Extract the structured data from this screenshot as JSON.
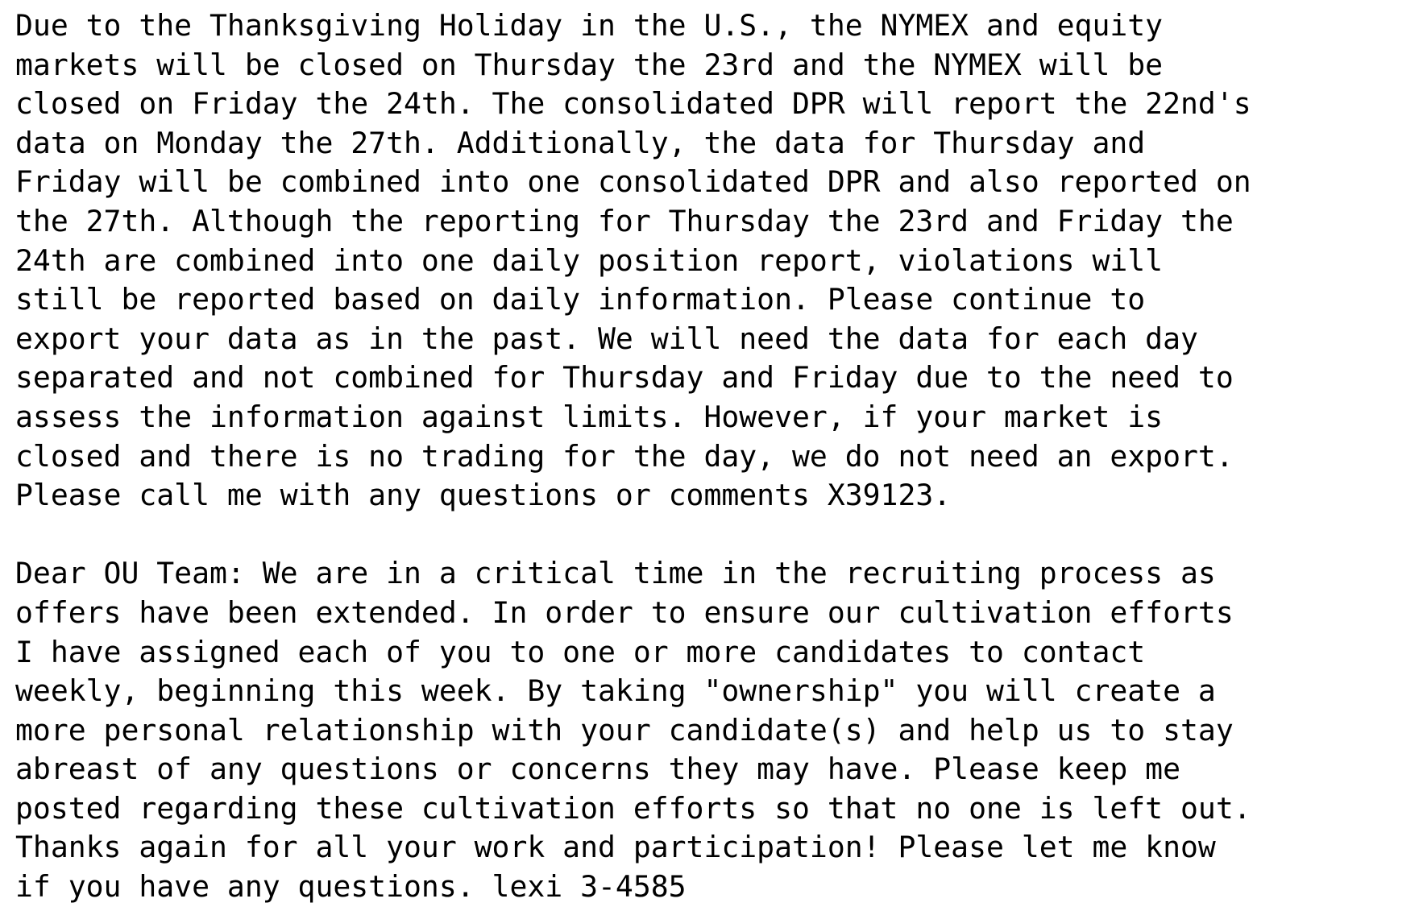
{
  "paragraphs": [
    {
      "lines": [
        "Due to the Thanksgiving Holiday in the U.S., the NYMEX and equity",
        "markets will be closed on Thursday the 23rd and the NYMEX will be",
        "closed on Friday the 24th. The consolidated DPR will report the 22nd's",
        "data on Monday the 27th. Additionally, the data for Thursday and",
        "Friday will be combined into one consolidated DPR and also reported on",
        "the 27th. Although the reporting for Thursday the 23rd and Friday the",
        "24th are combined into one daily position report, violations will",
        "still be reported based on daily information. Please continue to",
        "export your data as in the past. We will need the data for each day",
        "separated and not combined for Thursday and Friday due to the need to",
        "assess the information against limits. However, if your market is",
        "closed and there is no trading for the day, we do not need an export.",
        "Please call me with any questions or comments X39123."
      ]
    },
    {
      "lines": [
        "Dear OU Team: We are in a critical time in the recruiting process as",
        "offers have been extended. In order to ensure our cultivation efforts",
        "I have assigned each of you to one or more candidates to contact",
        "weekly, beginning this week. By taking \"ownership\" you will create a",
        "more personal relationship with your candidate(s) and help us to stay",
        "abreast of any questions or concerns they may have. Please keep me",
        "posted regarding these cultivation efforts so that no one is left out.",
        "Thanks again for all your work and participation! Please let me know",
        "if you have any questions. lexi 3-4585"
      ]
    }
  ]
}
